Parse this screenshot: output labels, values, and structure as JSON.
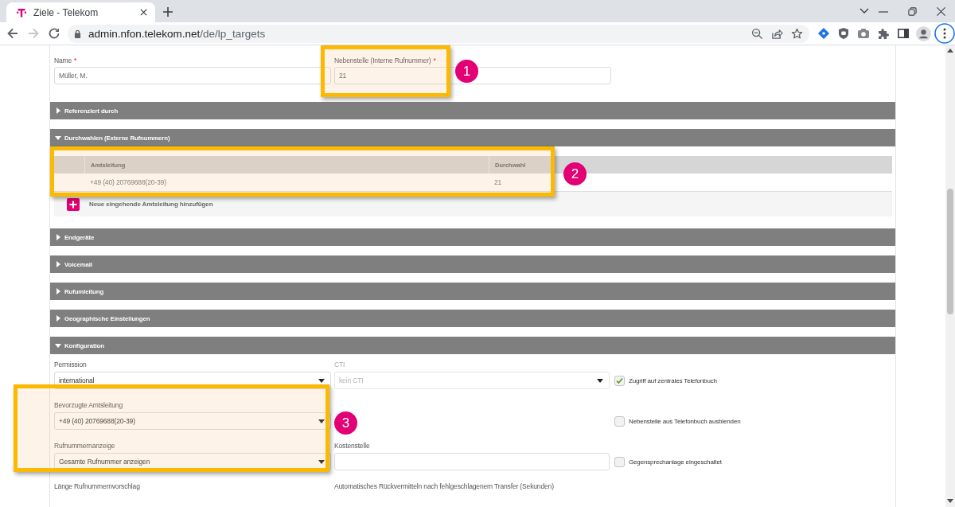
{
  "browser": {
    "tab_title": "Ziele - Telekom",
    "url_host": "admin.nfon.telekom.net",
    "url_path": "/de/lp_targets"
  },
  "top_fields": [
    {
      "label": "Name",
      "required_mark": "*",
      "value": "Müller, M."
    },
    {
      "label": "Nebenstelle (Interne Rufnummer)",
      "required_mark": "*",
      "value": "21",
      "annotation": "1"
    }
  ],
  "sections": [
    {
      "title": "Referenziert durch",
      "expanded": false
    },
    {
      "title": "Durchwahlen (Externe Rufnummern)",
      "expanded": true,
      "table": {
        "columns": [
          "Amtsleitung",
          "Durchwahl"
        ],
        "rows": [
          [
            "+49 (40) 20769688(20-39)",
            "21"
          ]
        ],
        "annotation": "2"
      },
      "add_action": "Neue eingehende Amtsleitung hinzufügen"
    },
    {
      "title": "Endgeräte",
      "expanded": false
    },
    {
      "title": "Voicemail",
      "expanded": false
    },
    {
      "title": "Rufumleitung",
      "expanded": false
    },
    {
      "title": "Geographische Einstellungen",
      "expanded": false
    },
    {
      "title": "Konfiguration",
      "expanded": true,
      "annotation": "3",
      "rows": [
        {
          "left": {
            "kind": "select",
            "label": "Permission",
            "value": "international",
            "disabled": false
          },
          "middle": {
            "kind": "select",
            "label": "CTI",
            "value": "kein CTI",
            "disabled": true
          },
          "option": {
            "label": "Zugriff auf zentrales Telefonbuch",
            "checked": true
          }
        },
        {
          "left": {
            "kind": "select",
            "label": "Bevorzugte Amtsleitung",
            "value": "+49 (40) 20769688(20-39)",
            "disabled": false
          },
          "option": {
            "label": "Nebenstelle aus Telefonbuch ausblenden",
            "checked": false
          }
        },
        {
          "left": {
            "kind": "select",
            "label": "Rufnummernanzeige",
            "value": "Gesamte Rufnummer anzeigen",
            "disabled": false
          },
          "middle": {
            "kind": "input",
            "label": "Kostenstelle",
            "disabled": false
          },
          "option": {
            "label": "Gegensprechanlage eingeschaltet",
            "checked": false
          }
        },
        {
          "left": {
            "kind": "label",
            "label": "Länge Rufnummernvorschlag"
          },
          "middle": {
            "kind": "label",
            "label": "Automatisches Rückvermitteln nach fehlgeschlagenem Transfer (Sekunden)"
          }
        }
      ]
    }
  ]
}
